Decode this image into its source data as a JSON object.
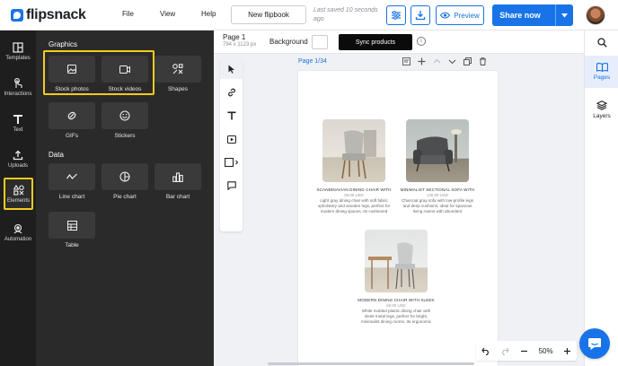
{
  "brand": {
    "name": "flipsnack",
    "accent": "#1873e8",
    "highlight": "#f2cc1b"
  },
  "topbar": {
    "menu": [
      "File",
      "View",
      "Help"
    ],
    "new_flipbook": "New flipbook",
    "saved_status": "Last saved 10 seconds ago",
    "preview": "Preview",
    "share": "Share now"
  },
  "rail": {
    "items": [
      {
        "label": "Templates",
        "icon": "templates-icon"
      },
      {
        "label": "Interactions",
        "icon": "pointer-icon"
      },
      {
        "label": "Text",
        "icon": "text-icon"
      },
      {
        "label": "Uploads",
        "icon": "upload-icon"
      },
      {
        "label": "Elements",
        "icon": "elements-icon",
        "active": true
      },
      {
        "label": "Automation",
        "icon": "automation-icon"
      }
    ]
  },
  "elements_panel": {
    "graphics_heading": "Graphics",
    "graphics": [
      {
        "label": "Stock photos",
        "icon": "image-icon"
      },
      {
        "label": "Stock videos",
        "icon": "video-icon"
      },
      {
        "label": "Shapes",
        "icon": "shapes-icon"
      },
      {
        "label": "GIFs",
        "icon": "gif-icon"
      },
      {
        "label": "Stickers",
        "icon": "sticker-icon"
      }
    ],
    "data_heading": "Data",
    "data": [
      {
        "label": "Line chart",
        "icon": "line-chart-icon"
      },
      {
        "label": "Pie chart",
        "icon": "pie-chart-icon"
      },
      {
        "label": "Bar chart",
        "icon": "bar-chart-icon"
      },
      {
        "label": "Table",
        "icon": "table-icon"
      }
    ]
  },
  "pagebar": {
    "page_name": "Page 1",
    "page_size": "794 x 1123 px",
    "background_label": "Background",
    "sync_products": "Sync products"
  },
  "canvas": {
    "page_indicator": "Page 1/34",
    "zoom": "50%",
    "products": [
      {
        "title": "SCANDINAVIAN DINING CHAIR WITH",
        "price": "55.00   USD",
        "desc": "Light gray dining chair with soft fabric upholstery and wooden legs, perfect for modern dining spaces. Its cushioned"
      },
      {
        "title": "MINIMALIST SECTIONAL SOFA WITH",
        "price": "140.00   USD",
        "desc": "Charcoal gray sofa with low-profile legs and deep cushions, ideal for spacious living rooms with abundant"
      },
      {
        "title": "MODERN DINING CHAIR WITH SLEEK",
        "price": "60.00   USD",
        "desc": "White molded plastic dining chair with sleek metal legs, perfect for bright, minimalist dining rooms. Its ergonomic"
      }
    ]
  },
  "right_panel": {
    "pages": "Pages",
    "layers": "Layers"
  }
}
